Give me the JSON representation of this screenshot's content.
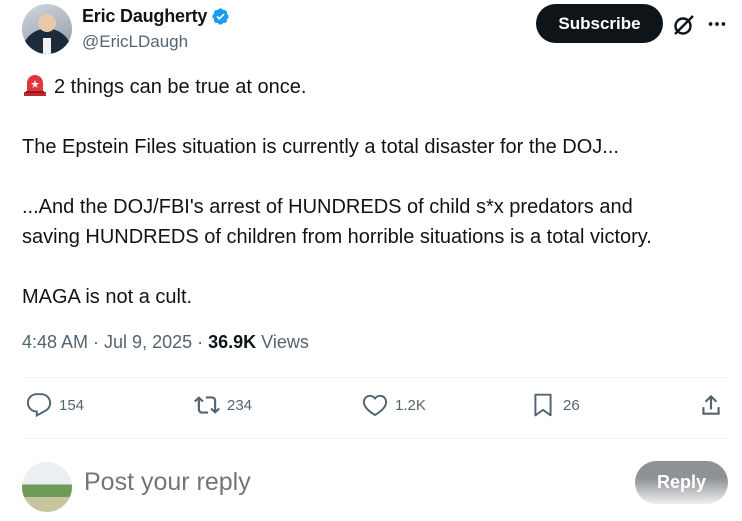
{
  "author": {
    "name": "Eric Daugherty",
    "handle": "@EricLDaugh",
    "verified": true
  },
  "header": {
    "subscribe_label": "Subscribe",
    "grok_icon": "grok-icon",
    "more_icon": "more-icon"
  },
  "post": {
    "line1": "2 things can be true at once.",
    "line2": "The Epstein Files situation is currently a total disaster for the DOJ...",
    "line3a": "...And the DOJ/FBI's arrest of HUNDREDS of child s*x predators and",
    "line3b": "saving HUNDREDS of children from horrible situations is a total victory.",
    "line4": "MAGA is not a cult.",
    "emoji": "rotating-light-emoji"
  },
  "meta": {
    "time": "4:48 AM",
    "sep1": " · ",
    "date": "Jul 9, 2025",
    "sep2": " · ",
    "views_count": "36.9K",
    "views_label": " Views"
  },
  "actions": {
    "replies": "154",
    "reposts": "234",
    "likes": "1.2K",
    "bookmarks": "26"
  },
  "reply_box": {
    "placeholder": "Post your reply",
    "button_label": "Reply"
  },
  "colors": {
    "accent_verified": "#1d9bf0",
    "secondary_text": "#536471",
    "primary_text": "#0f1419"
  }
}
